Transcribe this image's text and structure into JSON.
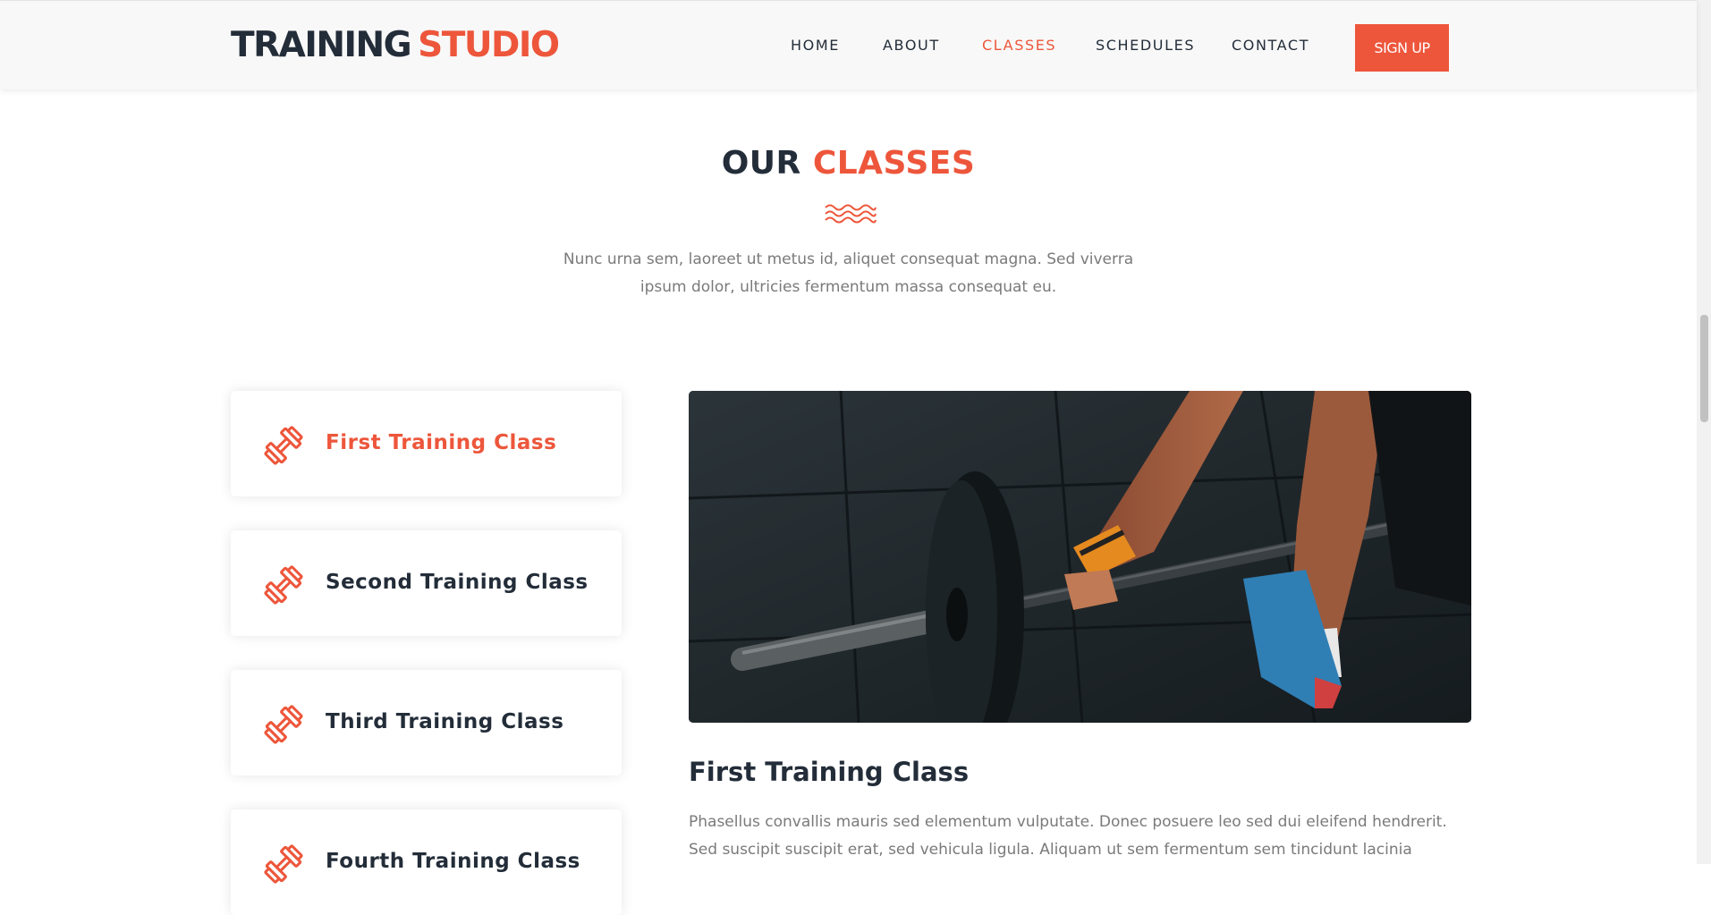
{
  "header": {
    "logo_primary": "TRAINING",
    "logo_accent": "STUDIO",
    "nav": [
      {
        "label": "HOME"
      },
      {
        "label": "ABOUT"
      },
      {
        "label": "CLASSES"
      },
      {
        "label": "SCHEDULES"
      },
      {
        "label": "CONTACT"
      }
    ],
    "active_nav": "CLASSES",
    "signup_label": "SIGN UP"
  },
  "section": {
    "title_primary": "OUR",
    "title_accent": "CLASSES",
    "intro_line1": "Nunc urna sem, laoreet ut metus id, aliquet consequat magna. Sed viverra",
    "intro_line2": "ipsum dolor, ultricies fermentum massa consequat eu."
  },
  "classes": {
    "tabs": [
      {
        "label": "First Training Class",
        "icon": "dumbbell-icon"
      },
      {
        "label": "Second Training Class",
        "icon": "dumbbell-icon"
      },
      {
        "label": "Third Training Class",
        "icon": "dumbbell-icon"
      },
      {
        "label": "Fourth Training Class",
        "icon": "dumbbell-icon"
      }
    ],
    "active_tab": "First Training Class",
    "content": {
      "title": "First Training Class",
      "desc_line1": "Phasellus convallis mauris sed elementum vulputate. Donec posuere leo sed dui eleifend hendrerit.",
      "desc_line2": "Sed suscipit suscipit erat, sed vehicula ligula. Aliquam ut sem fermentum sem tincidunt lacinia"
    }
  },
  "colors": {
    "accent": "#ed563b",
    "dark": "#232d39",
    "text_muted": "#7a7a7a"
  }
}
